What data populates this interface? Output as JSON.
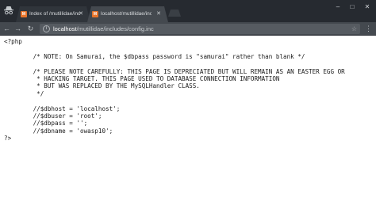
{
  "browser": {
    "tabs": [
      {
        "title": "Index of /mutillidae/inc",
        "active": false,
        "favicon": "mutillidae-favicon"
      },
      {
        "title": "localhost/mutillidae/inc",
        "active": true,
        "favicon": "mutillidae-favicon"
      }
    ],
    "address": {
      "host": "localhost",
      "path": "/mutillidae/includes/config.inc"
    },
    "window_controls": {
      "minimize": "–",
      "maximize": "□",
      "close": "✕"
    }
  },
  "file": {
    "lines": [
      "<?php",
      "",
      "\t/* NOTE: On Samurai, the $dbpass password is \"samurai\" rather than blank */",
      "",
      "\t/* PLEASE NOTE CAREFULLY: THIS PAGE IS DEPRECIATED BUT WILL REMAIN AS AN EASTER EGG OR",
      "\t * HACKING TARGET. THIS PAGE USED TO DATABASE CONNECTION INFORMATION",
      "\t * BUT WAS REPLACED BY THE MySQLHandler CLASS.",
      "\t */",
      "",
      "\t//$dbhost = 'localhost';",
      "\t//$dbuser = 'root';",
      "\t//$dbpass = '';",
      "\t//$dbname = 'owasp10';",
      "?>"
    ]
  },
  "colors": {
    "titlebar": "#262a30",
    "toolbar": "#44494f",
    "favicon": "#e8742a"
  }
}
